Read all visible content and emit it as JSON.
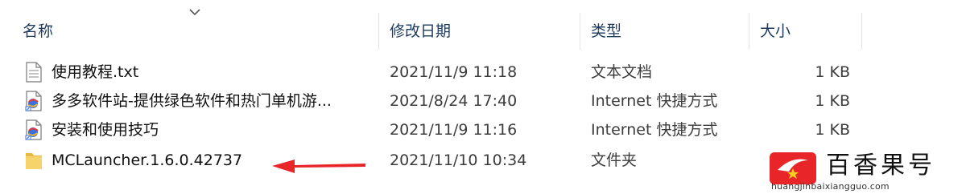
{
  "columns": {
    "name": "名称",
    "date": "修改日期",
    "type": "类型",
    "size": "大小"
  },
  "files": [
    {
      "icon": "text-file-icon",
      "name": "使用教程.txt",
      "date": "2021/11/9 11:18",
      "type": "文本文档",
      "size": "1 KB"
    },
    {
      "icon": "internet-shortcut-icon",
      "name": "多多软件站-提供绿色软件和热门单机游...",
      "date": "2021/8/24 17:40",
      "type": "Internet 快捷方式",
      "size": "1 KB"
    },
    {
      "icon": "internet-shortcut-icon",
      "name": "安装和使用技巧",
      "date": "2021/11/9 11:16",
      "type": "Internet 快捷方式",
      "size": "1 KB"
    },
    {
      "icon": "folder-icon",
      "name": "MCLauncher.1.6.0.42737",
      "date": "2021/11/10 10:34",
      "type": "文件夹",
      "size": ""
    }
  ],
  "watermark": {
    "text": "百香果号",
    "url": "huangjinbaixiangguo.com"
  },
  "colors": {
    "arrow": "#e8262a",
    "folder": "#f6d36b",
    "header_text": "#1e3a5f"
  }
}
